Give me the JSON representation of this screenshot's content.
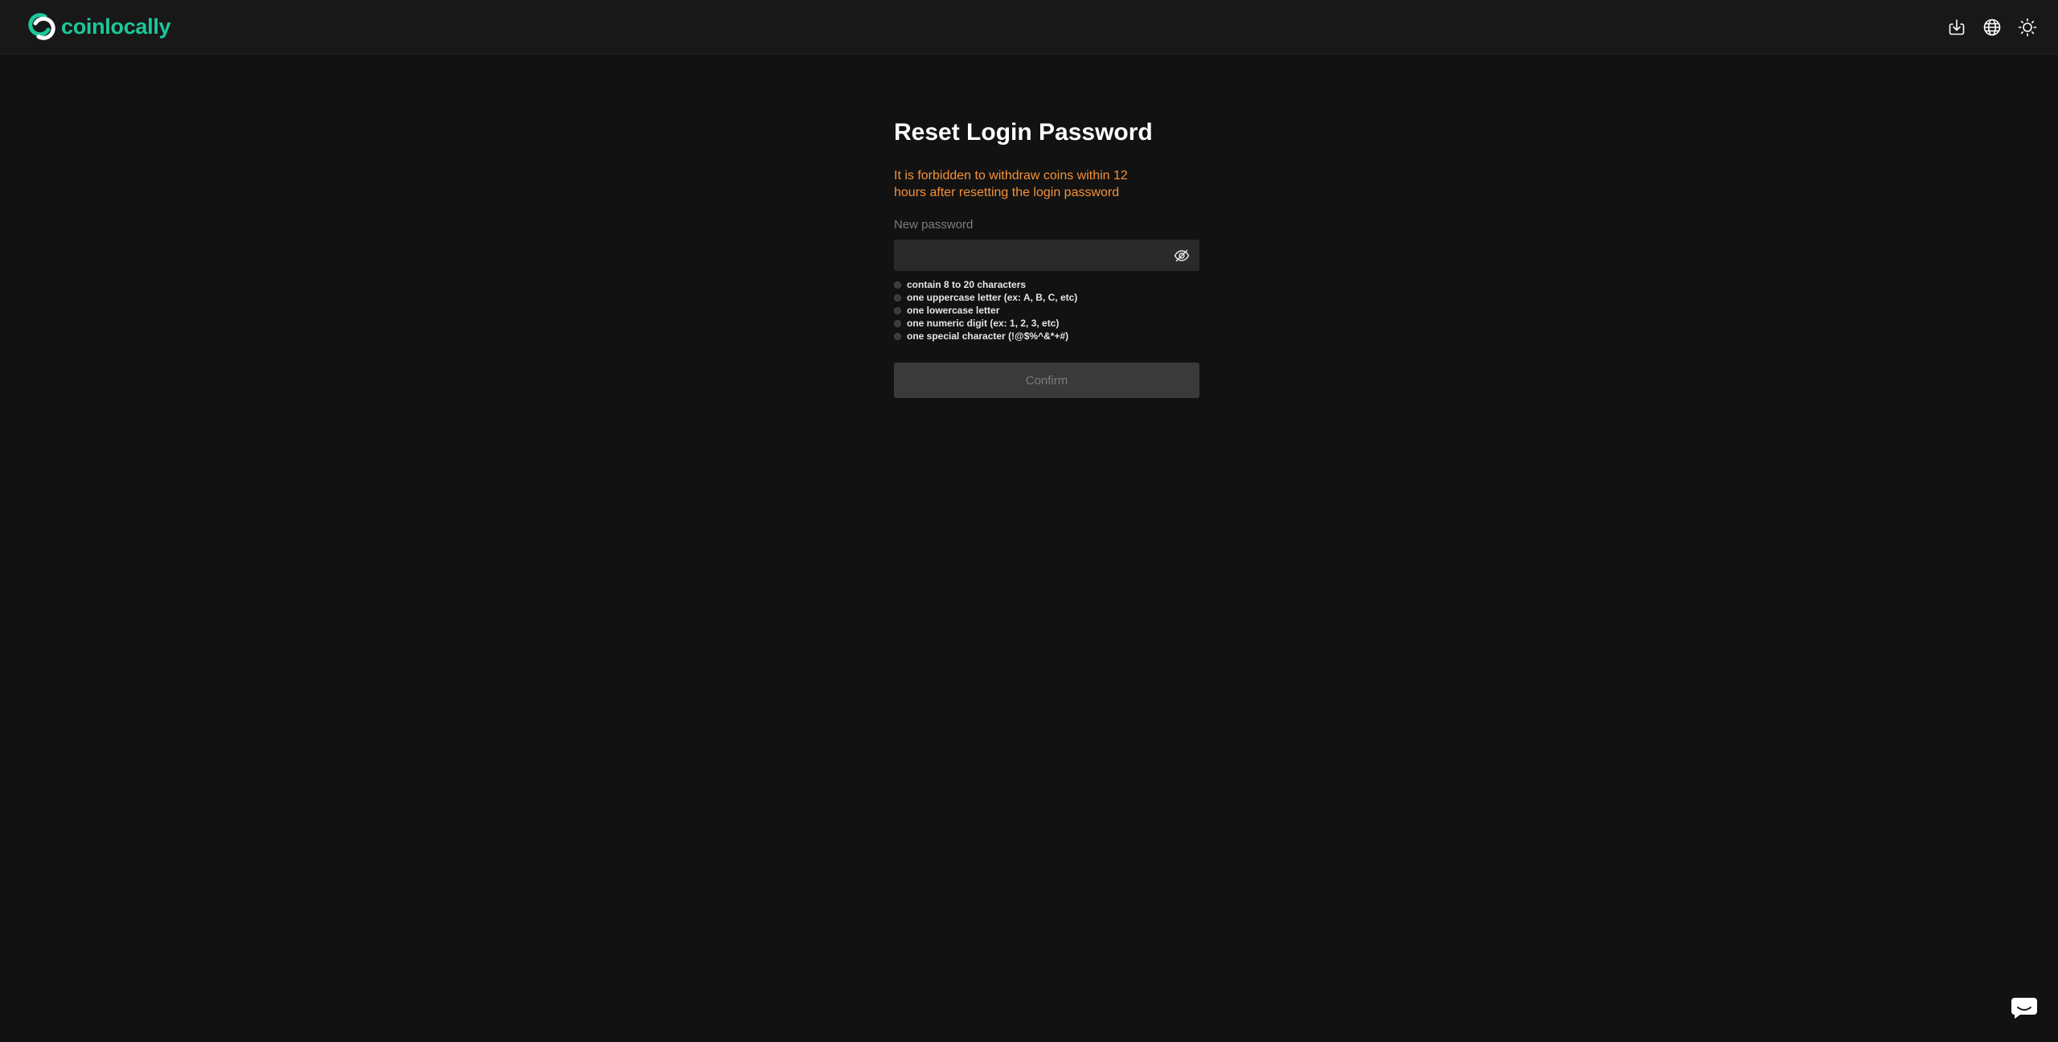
{
  "header": {
    "logo_text": "coinlocally",
    "brand_color": "#1bc89a",
    "actions": [
      {
        "icon": "download-icon"
      },
      {
        "icon": "globe-icon"
      },
      {
        "icon": "sun-icon"
      }
    ]
  },
  "reset_form": {
    "title": "Reset Login Password",
    "warning": "It is forbidden to withdraw coins within 12 hours after resetting the login password",
    "warning_color": "#f4923a",
    "password_label": "New password",
    "password_value": "",
    "password_placeholder": "",
    "toggle_icon": "eye-off-icon",
    "rules": [
      "contain 8 to 20 characters",
      "one uppercase letter (ex: A, B, C, etc)",
      "one lowercase letter",
      "one numeric digit (ex: 1, 2, 3, etc)",
      "one special character (!@$%^&*+#)"
    ],
    "confirm_label": "Confirm"
  },
  "support": {
    "icon": "chat-icon"
  }
}
